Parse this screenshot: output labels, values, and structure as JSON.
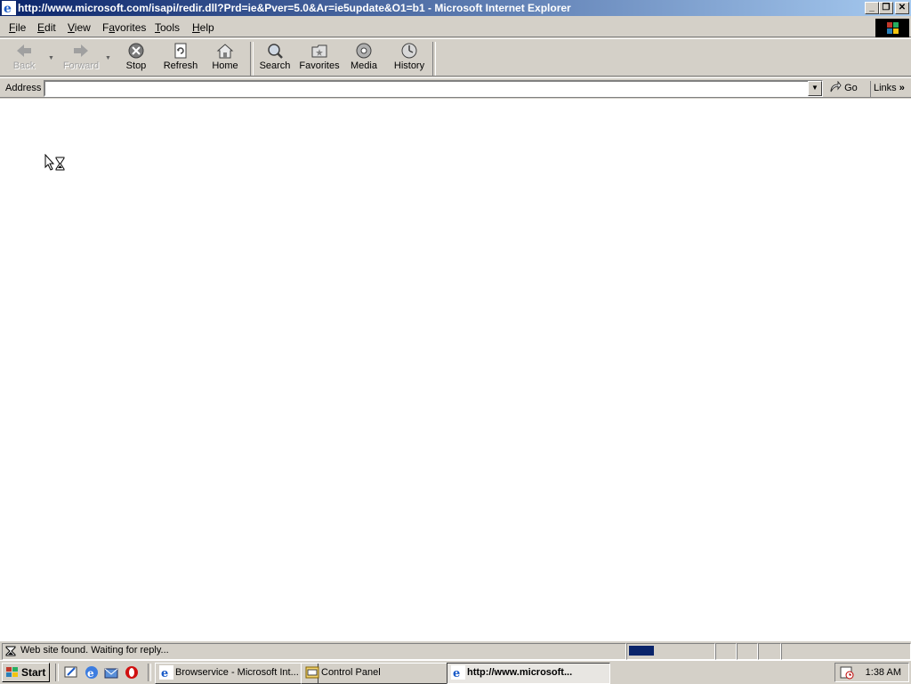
{
  "window": {
    "title": "http://www.microsoft.com/isapi/redir.dll?Prd=ie&Pver=5.0&Ar=ie5update&O1=b1 - Microsoft Internet Explorer",
    "controls": {
      "minimize": "_",
      "restore": "❐",
      "close": "✕"
    }
  },
  "menu": [
    {
      "prefix": "",
      "u": "F",
      "rest": "ile"
    },
    {
      "prefix": "",
      "u": "E",
      "rest": "dit"
    },
    {
      "prefix": "",
      "u": "V",
      "rest": "iew"
    },
    {
      "prefix": "F",
      "u": "a",
      "rest": "vorites"
    },
    {
      "prefix": "",
      "u": "T",
      "rest": "ools"
    },
    {
      "prefix": "",
      "u": "H",
      "rest": "elp"
    }
  ],
  "toolbar": {
    "back": "Back",
    "forward": "Forward",
    "stop": "Stop",
    "refresh": "Refresh",
    "home": "Home",
    "search": "Search",
    "favorites": "Favorites",
    "media": "Media",
    "history": "History"
  },
  "address": {
    "label": "Address",
    "value": "",
    "go": "Go",
    "links": "Links"
  },
  "status": {
    "text": "Web site found. Waiting for reply...",
    "progress_fraction": 0.3
  },
  "taskbar": {
    "start": "Start",
    "tasks": [
      {
        "label": "Browservice - Microsoft Int...",
        "active": false
      },
      {
        "label": "Control Panel",
        "active": false
      },
      {
        "label": "http://www.microsoft...",
        "active": true
      }
    ],
    "clock": "1:38 AM"
  },
  "colors": {
    "titlebar_start": "#0a246a",
    "titlebar_end": "#a6caf0",
    "face": "#d4d0c8",
    "progress": "#0a246a"
  }
}
